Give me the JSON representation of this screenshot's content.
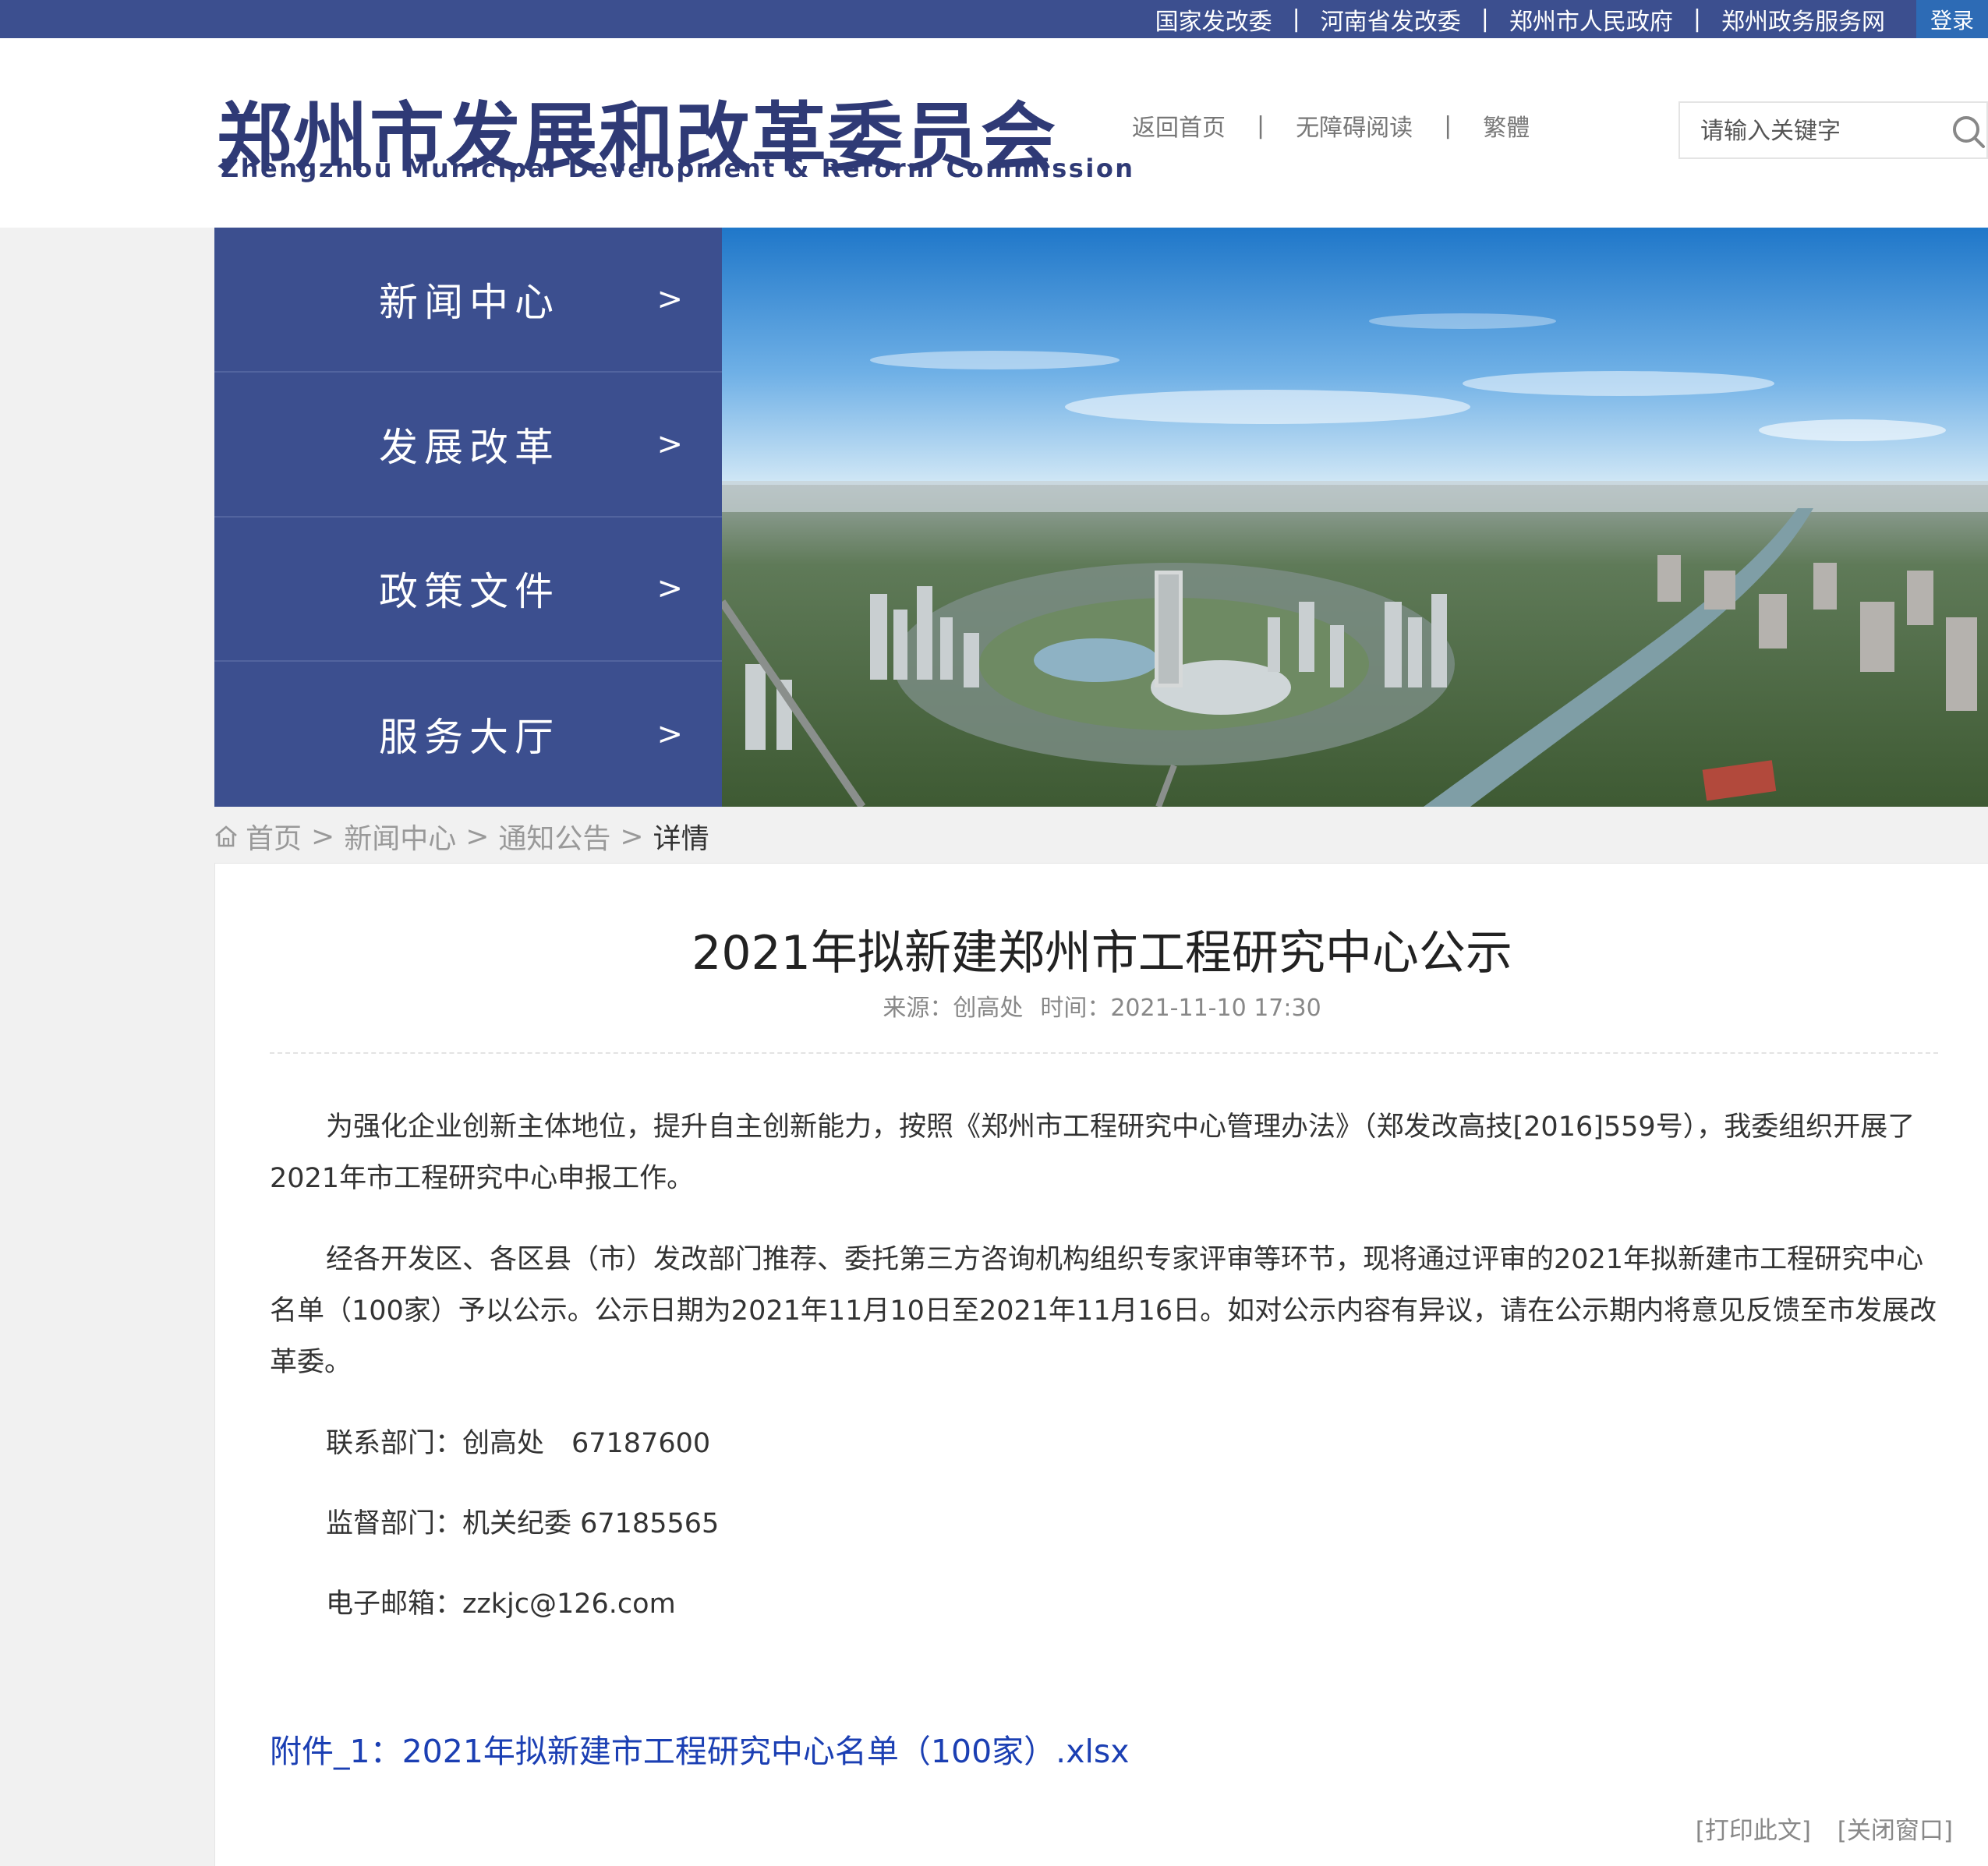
{
  "topbar": {
    "links": [
      "国家发改委",
      "河南省发改委",
      "郑州市人民政府",
      "郑州政务服务网"
    ],
    "login": "登录"
  },
  "header": {
    "logo_cn": "郑州市发展和改革委员会",
    "logo_en": "Zhengzhou Municipal Development & Reform Commission",
    "quick_links": [
      "返回首页",
      "无障碍阅读",
      "繁體"
    ],
    "search_placeholder": "请输入关键字"
  },
  "nav": {
    "items": [
      "新闻中心",
      "发展改革",
      "政策文件",
      "服务大厅"
    ],
    "arrow": ">"
  },
  "breadcrumb": {
    "items": [
      "首页",
      "新闻中心",
      "通知公告"
    ],
    "current": "详情",
    "separator": ">"
  },
  "article": {
    "title": "2021年拟新建郑州市工程研究中心公示",
    "source": "来源：创高处",
    "time": "时间：2021-11-10 17:30",
    "paragraphs": [
      "为强化企业创新主体地位，提升自主创新能力，按照《郑州市工程研究中心管理办法》（郑发改高技[2016]559号），我委组织开展了2021年市工程研究中心申报工作。",
      "经各开发区、各区县（市）发改部门推荐、委托第三方咨询机构组织专家评审等环节，现将通过评审的2021年拟新建市工程研究中心名单（100家）予以公示。公示日期为2021年11月10日至2021年11月16日。如对公示内容有异议，请在公示期内将意见反馈至市发展改革委。"
    ],
    "contacts": [
      "联系部门：创高处　67187600",
      "监督部门：机关纪委 67185565",
      "电子邮箱：zzkjc@126.com"
    ],
    "attachment": "附件_1：2021年拟新建市工程研究中心名单（100家）.xlsx",
    "actions": [
      "[打印此文]",
      "[关闭窗口]"
    ]
  },
  "colors": {
    "brand": "#3c4f8f",
    "login_bg": "#2d6bb5",
    "link": "#1b3fb3"
  }
}
